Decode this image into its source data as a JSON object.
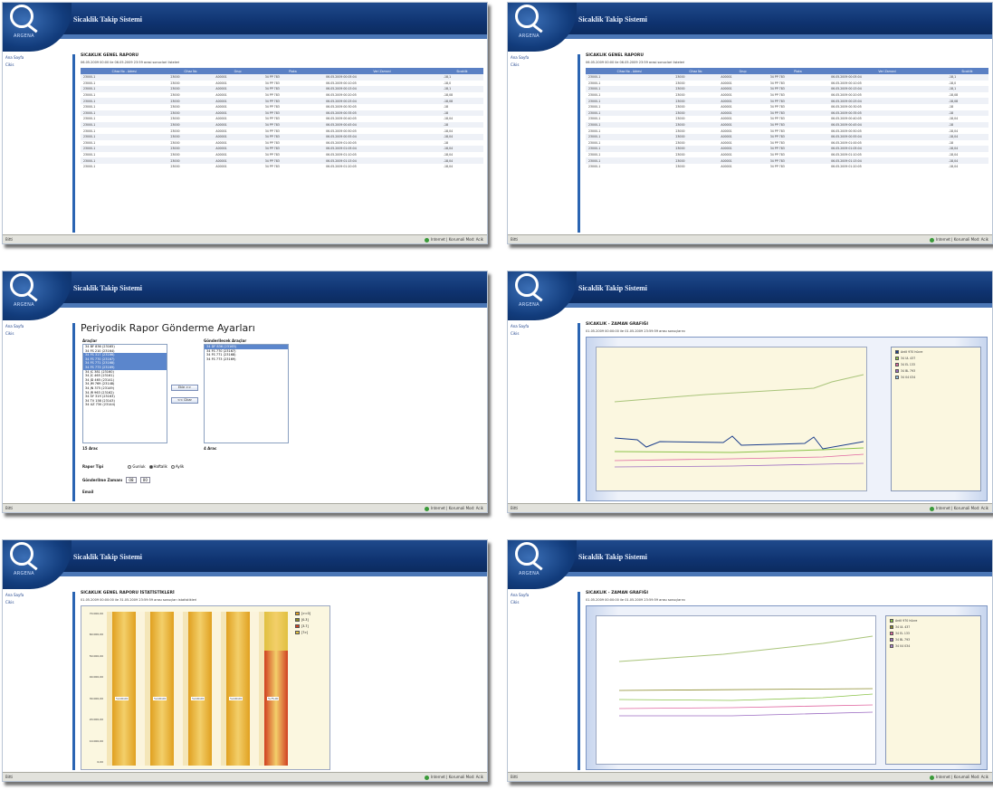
{
  "app": {
    "title": "Sicaklik Takip Sistemi",
    "logo_sub": "ARGENA",
    "sidebar": [
      "Ana Sayfa",
      "Cikis"
    ],
    "status_left": "Bitti",
    "status_right": "Internet | Korumali Mod: Acik"
  },
  "screen1": {
    "heading": "SICAKLIK GENEL RAPORU",
    "note": "06.05.2009 00:00 ile 06.05.2009 23:59 arasi sonuclari listeleri",
    "columns": [
      "Cihaz No - Adresi",
      "Cihaz No",
      "Grup",
      "Plaka",
      "Veri Zamani",
      "Sicaklik"
    ],
    "rows": [
      [
        "23000-1",
        "23000",
        "A00001",
        "34 PP 783",
        "06.05.2009 00:05:04",
        "-18,1"
      ],
      [
        "23000-1",
        "23000",
        "A00001",
        "34 PP 783",
        "06.05.2009 00:10:05",
        "-18,0"
      ],
      [
        "23000-1",
        "23000",
        "A00001",
        "34 PP 783",
        "06.05.2009 00:15:04",
        "-18,1"
      ],
      [
        "23000-1",
        "23000",
        "A00001",
        "34 PP 783",
        "06.05.2009 00:20:05",
        "-18,08"
      ],
      [
        "23000-1",
        "23000",
        "A00001",
        "34 PP 783",
        "06.05.2009 00:25:04",
        "-18,08"
      ],
      [
        "23000-1",
        "23000",
        "A00001",
        "34 PP 783",
        "06.05.2009 00:30:05",
        "-18"
      ],
      [
        "23000-1",
        "23000",
        "A00001",
        "34 PP 783",
        "06.05.2009 00:35:05",
        "-18"
      ],
      [
        "23000-1",
        "23000",
        "A00001",
        "34 PP 783",
        "06.05.2009 00:40:05",
        "-18,04"
      ],
      [
        "23000-1",
        "23000",
        "A00001",
        "34 PP 783",
        "06.05.2009 00:45:04",
        "-18"
      ],
      [
        "23000-1",
        "23000",
        "A00001",
        "34 PP 783",
        "06.05.2009 00:50:05",
        "-18,04"
      ],
      [
        "23000-1",
        "23000",
        "A00001",
        "34 PP 783",
        "06.05.2009 00:55:04",
        "-18,04"
      ],
      [
        "23000-1",
        "23000",
        "A00001",
        "34 PP 783",
        "06.05.2009 01:00:05",
        "-18"
      ],
      [
        "23000-1",
        "23000",
        "A00001",
        "34 PP 783",
        "06.05.2009 01:05:04",
        "-18,04"
      ],
      [
        "23000-1",
        "23000",
        "A00001",
        "34 PP 783",
        "06.05.2009 01:10:05",
        "-18,04"
      ],
      [
        "23000-1",
        "23000",
        "A00001",
        "34 PP 783",
        "06.05.2009 01:15:04",
        "-18,04"
      ],
      [
        "23000-1",
        "23000",
        "A00001",
        "34 PP 783",
        "06.05.2009 01:20:05",
        "-18,04"
      ]
    ]
  },
  "screen3": {
    "heading": "Periyodik Rapor Gönderme Ayarları",
    "left_label": "Araçlar",
    "right_label": "Gönderilecek Araçlar",
    "left_items": [
      "34 BF 836 (23165)",
      "34 FS 210 (23164)",
      "34 FS 317 (23166)",
      "34 FS 770 (23167)",
      "34 FS 771 (23168)",
      "34 FS 773 (23169)",
      "34 JC 381 (23160)",
      "34 JC 465 (23161)",
      "34 JD 465 (23141)",
      "34 JM 769 (23148)",
      "34 JN 375 (23149)",
      "34 JR 963 (23162)",
      "34 SY 319 (23163)",
      "34 TV 158 (23143)",
      "34 UZ 730 (23144)"
    ],
    "left_selected": [
      2,
      3,
      4,
      5
    ],
    "right_items": [
      "34 DF 836 (23165)",
      "34 FS 770 (23167)",
      "34 FS 771 (23168)",
      "34 FS 773 (23169)"
    ],
    "btn_add": "Ekle >>",
    "btn_remove": "<< Cikar",
    "left_count": "15 Arac",
    "right_count": "4 Arac",
    "report_type_label": "Rapor Tipi",
    "report_types": [
      "Gunluk",
      "Haftalik",
      "Aylik"
    ],
    "report_selected": 1,
    "send_time_label": "Gönderilme Zamanı",
    "hour": "08",
    "minute": "00",
    "email_label": "Email"
  },
  "screen4": {
    "heading": "SICAKLIK - ZAMAN GRAFIĞI",
    "note": "01.05.2009 00:00:00 ile 01.05.2009 23:59:59 arası sonuçlarını",
    "legend": [
      "Ardil 970 hücre",
      "34 UL 437",
      "34 EL 133",
      "34 BL 793",
      "34 04 034"
    ],
    "legend_colors": [
      "#1b3d8c",
      "#8bc34a",
      "#e066a0",
      "#9c6cc2",
      "#90c0e0"
    ]
  },
  "screen5": {
    "heading": "SICAKLIK GENEL RAPORU İSTATİSTİKLERİ",
    "note": "01.05.2009 00:00:00 ile 31.05.2009 23:59:59 arası sonuçları istatistikleri",
    "legend": [
      "[>=0]",
      "[0-3]",
      "[3-7]",
      "[7>]"
    ],
    "legend_colors": [
      "#e0a020",
      "#8a8a2a",
      "#d04020",
      "#e0c040"
    ],
    "yticks": [
      "70.000,00",
      "60.000,00",
      "50.000,00",
      "40.000,00",
      "30.000,00",
      "20.000,00",
      "10.000,00",
      "0,00"
    ],
    "bars": [
      {
        "label": "%100,00",
        "segments": [
          100
        ]
      },
      {
        "label": "%100,00",
        "segments": [
          100
        ]
      },
      {
        "label": "%100,00",
        "segments": [
          100
        ]
      },
      {
        "label": "%100,00",
        "segments": [
          100
        ]
      },
      {
        "label": "%75,00",
        "segments": [
          25,
          75
        ]
      }
    ]
  },
  "screen6": {
    "heading": "SICAKLIK - ZAMAN GRAFIĞI",
    "note": "01.05.2009 00:00:00 ile 01.05.2009 23:59:59 arası sonuçlarını",
    "legend": [
      "Ardil 970 hücre",
      "34 UL 437",
      "34 EL 133",
      "34 BL 793",
      "34 04 034"
    ],
    "legend_colors": [
      "#8bc34a",
      "#8a8a2a",
      "#e066a0",
      "#9c6cc2",
      "#b088d0"
    ]
  }
}
